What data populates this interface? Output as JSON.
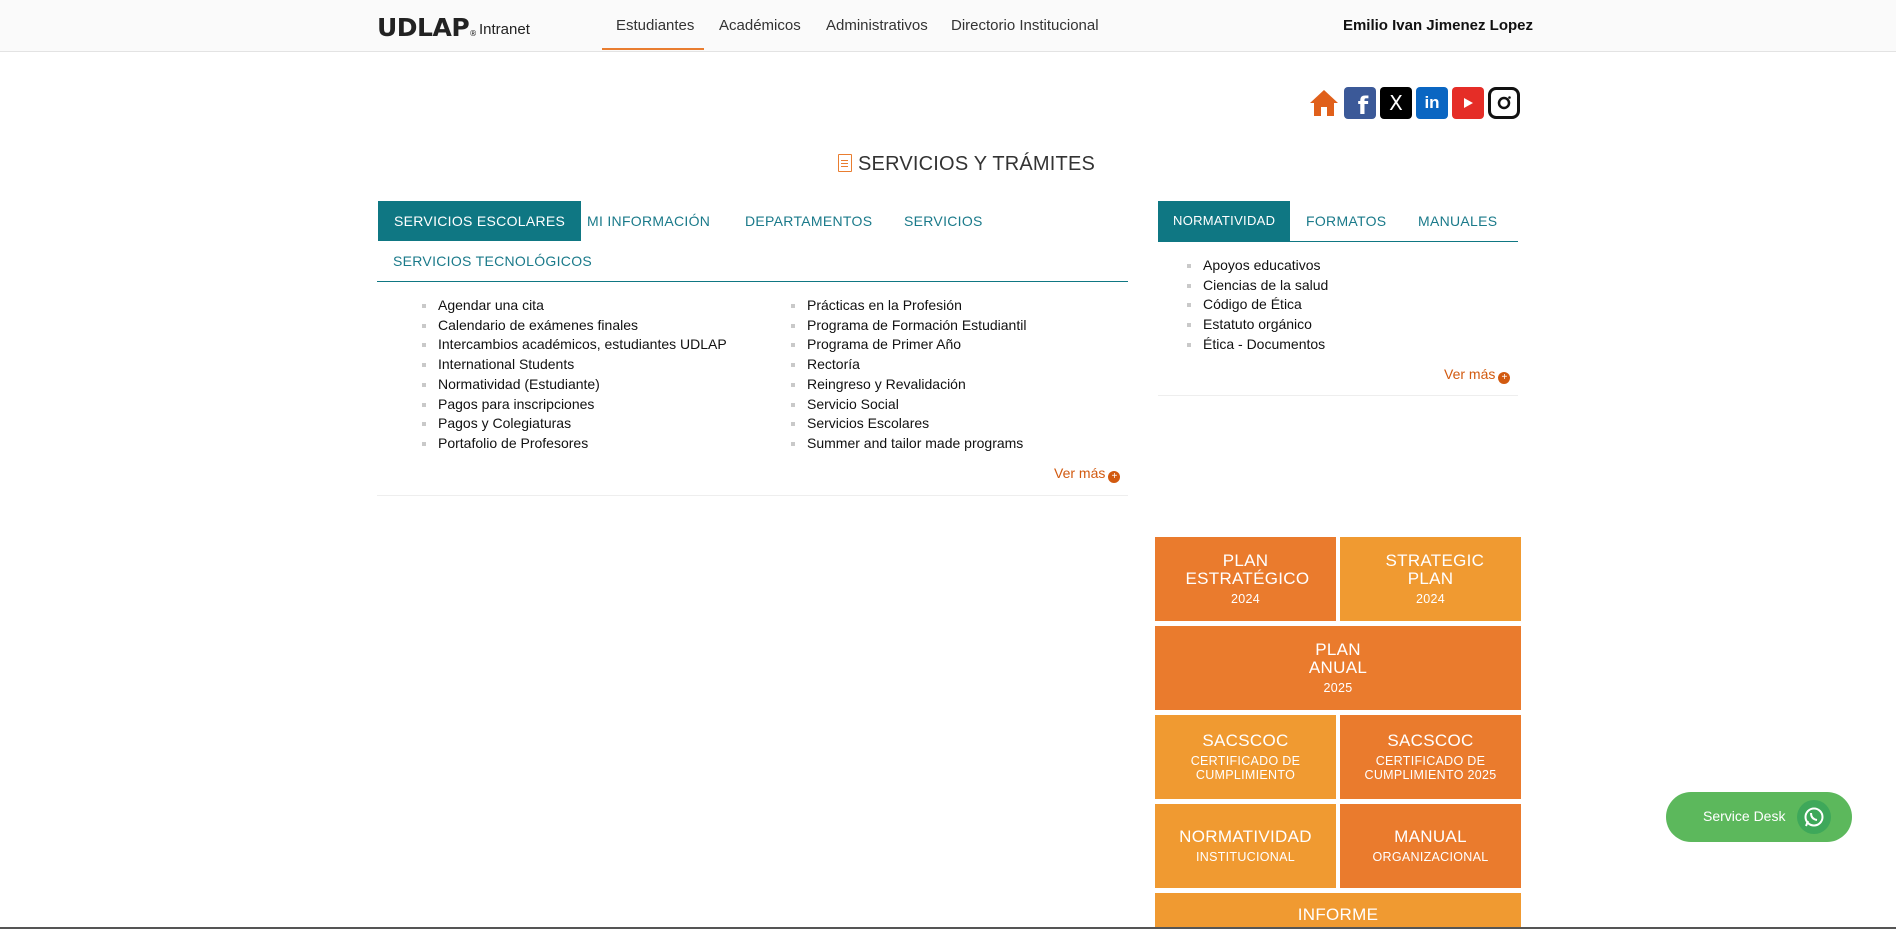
{
  "header": {
    "logo": "UDLAP",
    "logo_mark": "®",
    "logo_sub": "Intranet",
    "nav": [
      "Estudiantes",
      "Académicos",
      "Administrativos",
      "Directorio Institucional"
    ],
    "user": "Emilio Ivan Jimenez Lopez"
  },
  "social": {
    "icons": [
      "home-icon",
      "facebook-icon",
      "x-icon",
      "linkedin-icon",
      "youtube-icon",
      "instagram-icon"
    ],
    "fb_glyph": "f",
    "x_glyph": "X",
    "li_glyph": "in"
  },
  "section": {
    "title": "SERVICIOS Y TRÁMITES"
  },
  "left_tabs": [
    "SERVICIOS ESCOLARES",
    "MI INFORMACIÓN",
    "DEPARTAMENTOS",
    "SERVICIOS",
    "SERVICIOS TECNOLÓGICOS"
  ],
  "left_list_col1": [
    "Agendar una cita",
    "Calendario de exámenes finales",
    "Intercambios académicos, estudiantes UDLAP",
    "International Students",
    "Normatividad (Estudiante)",
    "Pagos para inscripciones",
    "Pagos y Colegiaturas",
    "Portafolio de Profesores"
  ],
  "left_list_col2": [
    "Prácticas en la Profesión",
    "Programa de Formación Estudiantil",
    "Programa de Primer Año",
    "Rectoría",
    "Reingreso y Revalidación",
    "Servicio Social",
    "Servicios Escolares",
    "Summer and tailor made programs"
  ],
  "ver_mas": "Ver más",
  "right_tabs": [
    "NORMATIVIDAD",
    "FORMATOS",
    "MANUALES"
  ],
  "right_list": [
    "Apoyos educativos",
    "Ciencias de la salud",
    "Código de Ética",
    "Estatuto orgánico",
    "Ética - Documentos"
  ],
  "tiles": [
    {
      "title": "PLAN ESTRATÉGICO",
      "sub": "2024"
    },
    {
      "title": "STRATEGIC PLAN",
      "sub": "2024"
    },
    {
      "title": "PLAN ANUAL",
      "sub": "2025"
    },
    {
      "title": "SACSCOC",
      "sub": "CERTIFICADO DE CUMPLIMIENTO"
    },
    {
      "title": "SACSCOC",
      "sub": "CERTIFICADO DE CUMPLIMIENTO 2025"
    },
    {
      "title": "NORMATIVIDAD",
      "sub": "INSTITUCIONAL"
    },
    {
      "title": "MANUAL",
      "sub": "ORGANIZACIONAL"
    },
    {
      "title": "INFORME",
      "sub": ""
    }
  ],
  "service_desk": "Service Desk",
  "colors": {
    "teal": "#0f7783",
    "orange": "#ea7b2d",
    "orange_light": "#f09a31",
    "link_orange": "#d25a10",
    "green": "#5cb85c"
  }
}
